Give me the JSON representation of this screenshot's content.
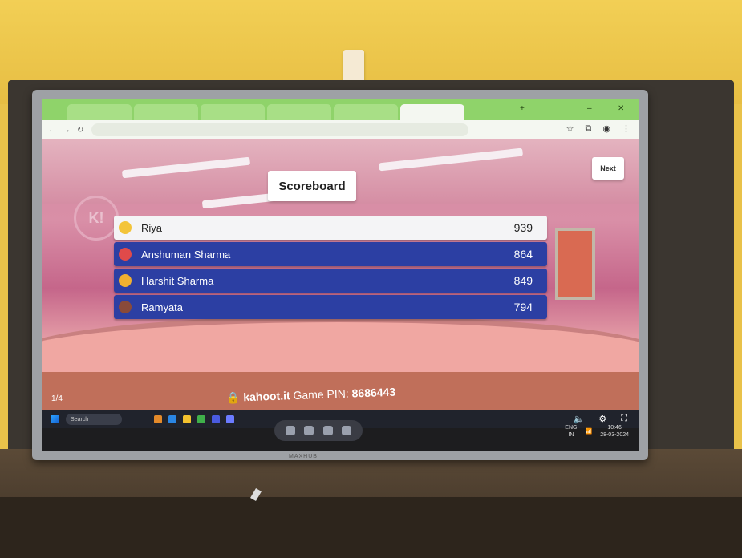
{
  "browser": {
    "tabs": [
      {
        "label": "",
        "active": false
      },
      {
        "label": "",
        "active": false
      },
      {
        "label": "",
        "active": false
      },
      {
        "label": "",
        "active": false
      },
      {
        "label": "",
        "active": false
      },
      {
        "label": "",
        "active": true
      }
    ],
    "url": "",
    "tab_add": "+",
    "win_min": "–",
    "win_close": "✕"
  },
  "game": {
    "title": "Scoreboard",
    "next_label": "Next",
    "page_counter": "1/4",
    "footer_brand": "kahoot.it",
    "footer_pin_label": "Game PIN:",
    "footer_pin": "8686443"
  },
  "leaderboard": [
    {
      "name": "Riya",
      "score": "939"
    },
    {
      "name": "Anshuman Sharma",
      "score": "864"
    },
    {
      "name": "Harshit Sharma",
      "score": "849"
    },
    {
      "name": "Ramyata",
      "score": "794"
    }
  ],
  "taskbar": {
    "search_placeholder": "Search",
    "lang_line1": "ENG",
    "lang_line2": "IN",
    "time": "10:46",
    "date": "28-03-2024"
  },
  "device": {
    "brand": "MAXHUB"
  },
  "colors": {
    "row_blue": "#2c3fa3",
    "row_first": "#f4f4f6",
    "tab_green": "#8fd36a"
  },
  "icons": [
    "back-icon",
    "forward-icon",
    "reload-icon",
    "star-icon",
    "extensions-icon",
    "profile-icon",
    "menu-icon",
    "lock-icon",
    "volume-icon",
    "settings-icon",
    "fullscreen-icon",
    "windows-start-icon"
  ]
}
